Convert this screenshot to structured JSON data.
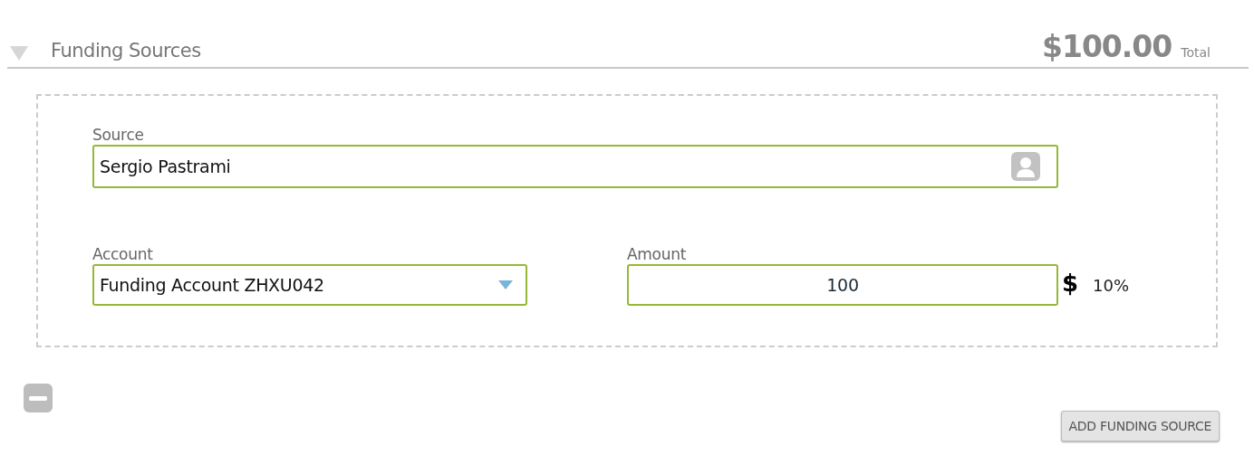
{
  "section": {
    "title": "Funding Sources",
    "expanded": true,
    "total": "$100.00",
    "total_label": "Total"
  },
  "source": {
    "label": "Source",
    "value": "Sergio Pastrami"
  },
  "account": {
    "label": "Account",
    "value": "Funding Account ZHXU042"
  },
  "amount": {
    "label": "Amount",
    "value": "100",
    "currency": "$",
    "percent": "10%"
  },
  "add_button": "ADD FUNDING SOURCE"
}
